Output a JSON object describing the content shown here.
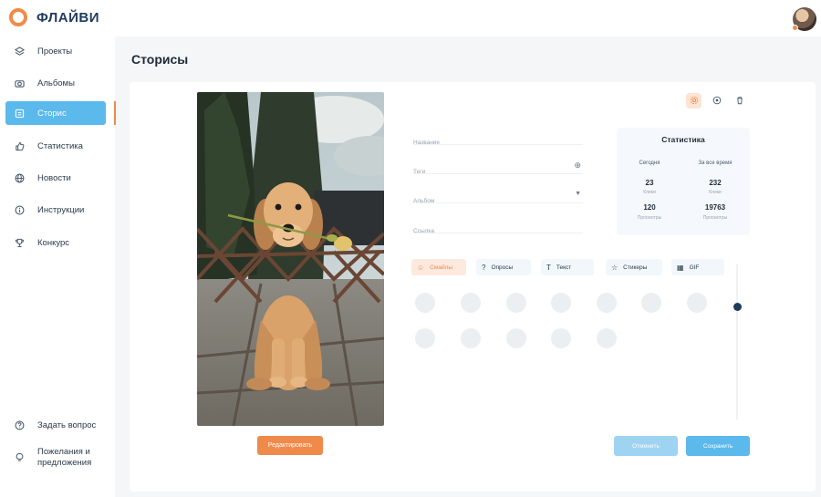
{
  "app": {
    "brand": "ФЛАЙВИ"
  },
  "sidebar": {
    "items": [
      {
        "label": "Проекты",
        "icon": "layers-icon"
      },
      {
        "label": "Альбомы",
        "icon": "camera-icon"
      },
      {
        "label": "Сторис",
        "icon": "stories-icon",
        "active": true
      },
      {
        "label": "Статистика",
        "icon": "thumb-up-icon"
      },
      {
        "label": "Новости",
        "icon": "globe-icon"
      },
      {
        "label": "Инструкции",
        "icon": "info-icon"
      },
      {
        "label": "Конкурс",
        "icon": "trophy-icon"
      }
    ],
    "bottom": [
      {
        "label": "Задать вопрос",
        "icon": "question-icon"
      },
      {
        "label": "Пожелания и предложения",
        "icon": "lightbulb-icon"
      }
    ]
  },
  "page": {
    "title": "Сторисы"
  },
  "editor": {
    "edit_button": "Редактировать",
    "fields": [
      {
        "placeholder": "Название"
      },
      {
        "placeholder": "Теги"
      },
      {
        "placeholder": "Альбом"
      },
      {
        "placeholder": "Ссылка"
      }
    ]
  },
  "stats": {
    "title": "Статистика",
    "columns": [
      {
        "header": "Сегодня",
        "clicks": "23",
        "clicks_label": "Клики",
        "views": "120",
        "views_label": "Просмотры"
      },
      {
        "header": "За все время",
        "clicks": "232",
        "clicks_label": "Клики",
        "views": "19763",
        "views_label": "Просмотры"
      }
    ]
  },
  "tabs": [
    {
      "label": "Смайлы",
      "icon": "smile-icon",
      "active": true
    },
    {
      "label": "Опросы",
      "icon": "question-icon"
    },
    {
      "label": "Текст",
      "icon": "text-icon"
    },
    {
      "label": "Стикеры",
      "icon": "star-icon"
    },
    {
      "label": "GIF",
      "icon": "gif-icon"
    }
  ],
  "actions": {
    "preview": "Отменить",
    "save": "Сохранить"
  },
  "colors": {
    "accent": "#f08a4b",
    "primary": "#5bb9ec",
    "navy": "#1f3b5c"
  }
}
